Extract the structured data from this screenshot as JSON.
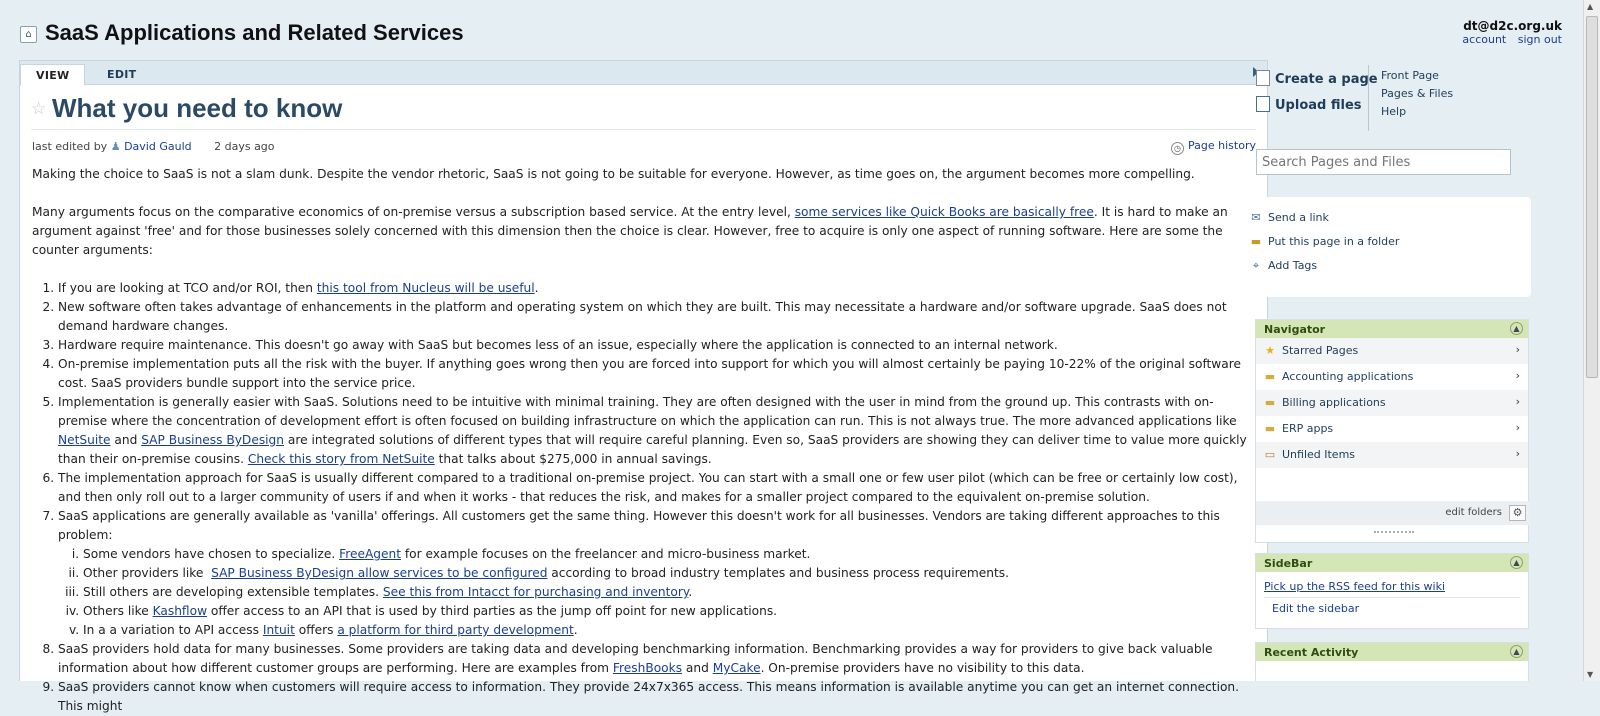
{
  "header": {
    "wiki_title": "SaaS Applications and Related Services",
    "user_email": "dt@d2c.org.uk",
    "account_label": "account",
    "signout_label": "sign out"
  },
  "tabs": {
    "view": "VIEW",
    "edit": "EDIT"
  },
  "page": {
    "title": "What you need to know",
    "meta_prefix": "last edited by",
    "author": "David Gauld",
    "edited": "2 days ago",
    "history_label": "Page history"
  },
  "content": {
    "p1": "Making the choice to SaaS is not a slam dunk. Despite the vendor rhetoric, SaaS is not going to be suitable for everyone. However, as time goes on, the argument becomes more compelling.",
    "p2a": "Many arguments focus on the comparative economics of on-premise versus a subscription based service. At the entry level, ",
    "p2link": "some services like Quick Books are basically free",
    "p2b": ". It is hard to make an argument against 'free' and for those businesses solely concerned with this dimension then the choice is clear. However, free to acquire is only one aspect of running software. Here are some the counter arguments:",
    "li1a": "If you are looking at TCO and/or ROI, then ",
    "li1link": "this tool from Nucleus will be useful",
    "li1b": ".",
    "li2": "New software often takes advantage of enhancements in the platform and operating system on which they are built. This may necessitate a hardware and/or software upgrade. SaaS does not demand hardware changes.",
    "li3": "Hardware require maintenance. This doesn't go away with SaaS but becomes less of an issue, especially where the application is connected to an internal network.",
    "li4": "On-premise implementation puts all the risk with the buyer. If anything goes wrong then you are forced into support for which you will almost certainly be paying 10-22% of the original software cost. SaaS providers bundle support into the service price.",
    "li5a": "Implementation is generally easier with SaaS. Solutions need to be intuitive with minimal training. They are often designed with the user in mind from the ground up. This contrasts with on-premise where the concentration of development effort is often focused on building infrastructure on which the application can run. This is not always true. The more advanced applications like ",
    "li5link1": "NetSuite",
    "li5b": " and ",
    "li5link2": "SAP Business ByDesign",
    "li5c": " are integrated solutions of different types that will require careful planning. Even so, SaaS providers are showing they can deliver time to value more quickly than their on-premise cousins. ",
    "li5link3": "Check this story from NetSuite",
    "li5d": " that talks about $275,000 in annual savings.",
    "li6": "The implementation approach for SaaS is usually different compared to a traditional on-premise project.  You can start with a small one or few user pilot (which can be free or certainly low cost), and then only roll out to a larger community of users if and when it works - that reduces the risk, and makes for a smaller project compared to the equivalent on-premise solution.",
    "li7": "SaaS applications are generally available as 'vanilla' offerings. All customers get the same thing. However this doesn't work for all businesses. Vendors are taking different approaches to this problem:",
    "r1a": "Some vendors have chosen to specialize. ",
    "r1link": "FreeAgent",
    "r1b": " for example focuses on the freelancer and micro-business market.",
    "r2a": "Other providers like  ",
    "r2link": "SAP Business ByDesign allow services to be configured",
    "r2b": " according to broad industry templates and business process requirements.",
    "r3a": "Still others are developing extensible templates. ",
    "r3link": "See this from Intacct for purchasing and inventory",
    "r3b": ".",
    "r4a": "Others like ",
    "r4link": "Kashflow",
    "r4b": " offer access to an API that is used by third parties as the jump off point for new applications.",
    "r5a": "In a a variation to API access ",
    "r5link1": "Intuit",
    "r5b": " offers ",
    "r5link2": "a platform for third party development",
    "r5c": ".",
    "li8a": "SaaS providers hold data for many businesses. Some providers are taking data and developing benchmarking information. Benchmarking provides a way for providers to give back valuable information about how different customer groups are performing. Here are examples from ",
    "li8link1": "FreshBooks",
    "li8b": " and ",
    "li8link2": "MyCake",
    "li8c": ". On-premise providers have no visibility to this data.",
    "li9": "SaaS providers cannot know when customers will require access to information. They provide 24x7x365 access. This means information is available anytime you can get an internet connection. This might"
  },
  "rail": {
    "create_page": "Create a page",
    "upload_files": "Upload files",
    "front_page": "Front Page",
    "pages_files": "Pages & Files",
    "help": "Help",
    "search_placeholder": "Search Pages and Files",
    "send_link": "Send a link",
    "put_folder": "Put this page in a folder",
    "add_tags": "Add Tags"
  },
  "navigator": {
    "title": "Navigator",
    "items": [
      "Starred Pages",
      "Accounting applications",
      "Billing applications",
      "ERP apps",
      "Unfiled Items"
    ],
    "edit_folders": "edit folders"
  },
  "sidebar": {
    "title": "SideBar",
    "rss": "Pick up the RSS feed for this wiki",
    "edit": "Edit the sidebar"
  },
  "recent": {
    "title": "Recent Activity"
  }
}
